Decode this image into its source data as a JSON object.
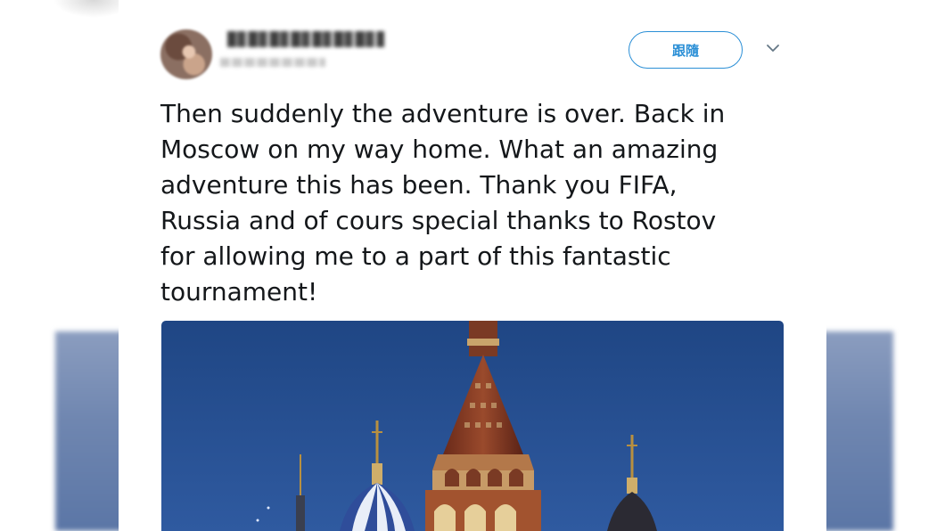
{
  "tweet": {
    "follow_label": "跟隨",
    "text_lines": [
      "Then suddenly the adventure is over. Back in",
      "Moscow on my way home. What an amazing",
      "adventure this has been. Thank you FIFA,",
      "Russia and of cours special thanks to Rostov",
      "for allowing me to a part of this fantastic",
      "tournament!"
    ],
    "icons": {
      "more": "chevron-down-icon",
      "avatar": "avatar"
    }
  },
  "colors": {
    "accent": "#2b8fd6",
    "text": "#14171a",
    "sky": "#2a4f86"
  }
}
